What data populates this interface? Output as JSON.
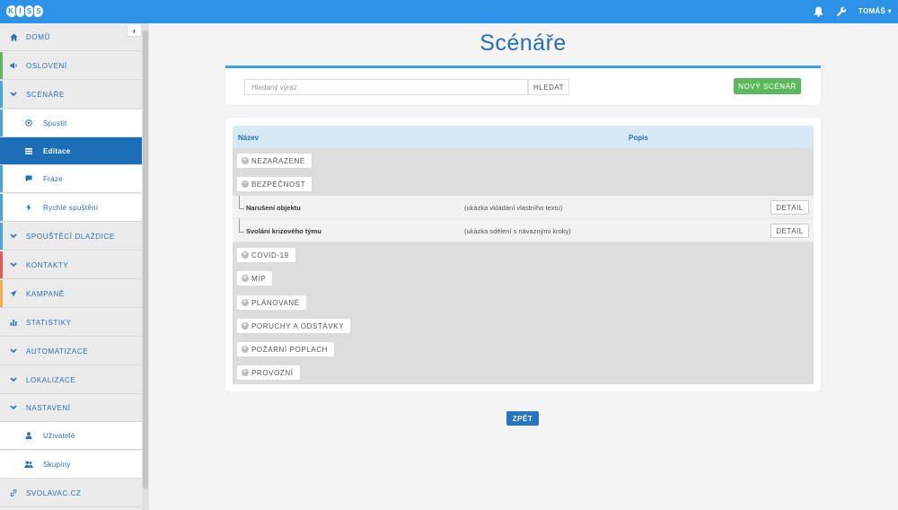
{
  "header": {
    "logo_letters": [
      "K",
      "I",
      "S",
      "S"
    ],
    "user_label": "TOMÁŠ ▾",
    "icons": [
      "bell-icon",
      "wrench-icon"
    ]
  },
  "sidebar": {
    "collapse_icon": "chevron-left-icon",
    "items": [
      {
        "label": "DOMŮ",
        "icon": "home-icon",
        "stripe": ""
      },
      {
        "label": "OSLOVENÍ",
        "icon": "speaker-icon",
        "stripe": "#5cb85c"
      },
      {
        "label": "SCÉNÁŘE",
        "icon": "chevron-down-icon",
        "stripe": "#4aa3df"
      },
      {
        "label": "Spustit",
        "icon": "play-circle-icon",
        "stripe": "#4aa3df"
      },
      {
        "label": "Editace",
        "icon": "list-icon",
        "stripe": "#4aa3df"
      },
      {
        "label": "Fráze",
        "icon": "comment-icon",
        "stripe": "#4aa3df"
      },
      {
        "label": "Rychlé spuštění",
        "icon": "bolt-icon",
        "stripe": "#4aa3df"
      },
      {
        "label": "SPOUŠTĚCÍ DLAŽDICE",
        "icon": "chevron-down-icon",
        "stripe": "#4aa3df"
      },
      {
        "label": "KONTAKTY",
        "icon": "chevron-down-icon",
        "stripe": "#e05a5a"
      },
      {
        "label": "KAMPANĚ",
        "icon": "send-icon",
        "stripe": "#f0ad4e"
      },
      {
        "label": "STATISTIKY",
        "icon": "bar-chart-icon",
        "stripe": ""
      },
      {
        "label": "AUTOMATIZACE",
        "icon": "chevron-down-icon",
        "stripe": ""
      },
      {
        "label": "LOKALIZACE",
        "icon": "chevron-down-icon",
        "stripe": ""
      },
      {
        "label": "NASTAVENÍ",
        "icon": "chevron-down-icon",
        "stripe": ""
      },
      {
        "label": "Uživatelé",
        "icon": "user-icon",
        "stripe": ""
      },
      {
        "label": "Skupiny",
        "icon": "users-icon",
        "stripe": ""
      },
      {
        "label": "SVOLAVAC.CZ",
        "icon": "link-icon",
        "stripe": ""
      }
    ]
  },
  "main": {
    "title": "Scénáře",
    "search": {
      "placeholder": "Hledaný výraz",
      "button": "HLEDAT"
    },
    "new_button": "NOVÝ SCÉNÁŘ",
    "table": {
      "columns": [
        "Název",
        "Popis"
      ],
      "groups": [
        {
          "label": "NEZAŘAZENÉ",
          "expanded": false
        },
        {
          "label": "BEZPEČNOST",
          "expanded": true
        },
        {
          "label": "COVID-19",
          "expanded": false
        },
        {
          "label": "MIP",
          "expanded": false
        },
        {
          "label": "PLÁNOVANÉ",
          "expanded": false
        },
        {
          "label": "PORUCHY A ODSTÁVKY",
          "expanded": false
        },
        {
          "label": "POŽÁRNÍ POPLACH",
          "expanded": false
        },
        {
          "label": "PROVOZNÍ",
          "expanded": false
        }
      ],
      "rows": [
        {
          "name": "Narušení objektu",
          "description": "(ukázka vkládání vlastního textu)",
          "action": "DETAIL"
        },
        {
          "name": "Svolání krizového týmu",
          "description": "(ukázka sdělení s návaznými kroky)",
          "action": "DETAIL"
        }
      ]
    },
    "back_button": "ZPĚT"
  },
  "colors": {
    "topbar": "#2b92e8",
    "accent": "#2a6eb5",
    "active_item": "#1c6eb8",
    "new_button": "#5cb85c"
  }
}
